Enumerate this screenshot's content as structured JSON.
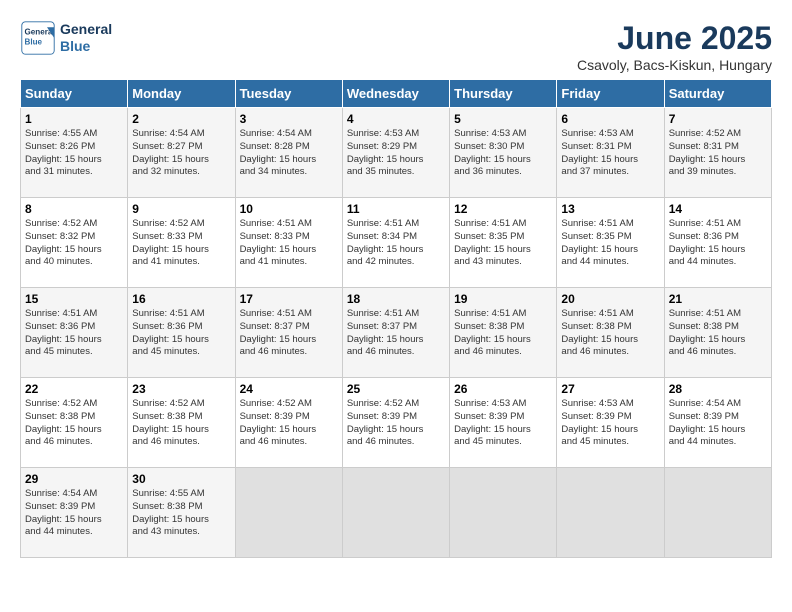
{
  "logo": {
    "line1": "General",
    "line2": "Blue"
  },
  "title": "June 2025",
  "location": "Csavoly, Bacs-Kiskun, Hungary",
  "days_of_week": [
    "Sunday",
    "Monday",
    "Tuesday",
    "Wednesday",
    "Thursday",
    "Friday",
    "Saturday"
  ],
  "weeks": [
    [
      {
        "day": "1",
        "info": "Sunrise: 4:55 AM\nSunset: 8:26 PM\nDaylight: 15 hours\nand 31 minutes."
      },
      {
        "day": "2",
        "info": "Sunrise: 4:54 AM\nSunset: 8:27 PM\nDaylight: 15 hours\nand 32 minutes."
      },
      {
        "day": "3",
        "info": "Sunrise: 4:54 AM\nSunset: 8:28 PM\nDaylight: 15 hours\nand 34 minutes."
      },
      {
        "day": "4",
        "info": "Sunrise: 4:53 AM\nSunset: 8:29 PM\nDaylight: 15 hours\nand 35 minutes."
      },
      {
        "day": "5",
        "info": "Sunrise: 4:53 AM\nSunset: 8:30 PM\nDaylight: 15 hours\nand 36 minutes."
      },
      {
        "day": "6",
        "info": "Sunrise: 4:53 AM\nSunset: 8:31 PM\nDaylight: 15 hours\nand 37 minutes."
      },
      {
        "day": "7",
        "info": "Sunrise: 4:52 AM\nSunset: 8:31 PM\nDaylight: 15 hours\nand 39 minutes."
      }
    ],
    [
      {
        "day": "8",
        "info": "Sunrise: 4:52 AM\nSunset: 8:32 PM\nDaylight: 15 hours\nand 40 minutes."
      },
      {
        "day": "9",
        "info": "Sunrise: 4:52 AM\nSunset: 8:33 PM\nDaylight: 15 hours\nand 41 minutes."
      },
      {
        "day": "10",
        "info": "Sunrise: 4:51 AM\nSunset: 8:33 PM\nDaylight: 15 hours\nand 41 minutes."
      },
      {
        "day": "11",
        "info": "Sunrise: 4:51 AM\nSunset: 8:34 PM\nDaylight: 15 hours\nand 42 minutes."
      },
      {
        "day": "12",
        "info": "Sunrise: 4:51 AM\nSunset: 8:35 PM\nDaylight: 15 hours\nand 43 minutes."
      },
      {
        "day": "13",
        "info": "Sunrise: 4:51 AM\nSunset: 8:35 PM\nDaylight: 15 hours\nand 44 minutes."
      },
      {
        "day": "14",
        "info": "Sunrise: 4:51 AM\nSunset: 8:36 PM\nDaylight: 15 hours\nand 44 minutes."
      }
    ],
    [
      {
        "day": "15",
        "info": "Sunrise: 4:51 AM\nSunset: 8:36 PM\nDaylight: 15 hours\nand 45 minutes."
      },
      {
        "day": "16",
        "info": "Sunrise: 4:51 AM\nSunset: 8:36 PM\nDaylight: 15 hours\nand 45 minutes."
      },
      {
        "day": "17",
        "info": "Sunrise: 4:51 AM\nSunset: 8:37 PM\nDaylight: 15 hours\nand 46 minutes."
      },
      {
        "day": "18",
        "info": "Sunrise: 4:51 AM\nSunset: 8:37 PM\nDaylight: 15 hours\nand 46 minutes."
      },
      {
        "day": "19",
        "info": "Sunrise: 4:51 AM\nSunset: 8:38 PM\nDaylight: 15 hours\nand 46 minutes."
      },
      {
        "day": "20",
        "info": "Sunrise: 4:51 AM\nSunset: 8:38 PM\nDaylight: 15 hours\nand 46 minutes."
      },
      {
        "day": "21",
        "info": "Sunrise: 4:51 AM\nSunset: 8:38 PM\nDaylight: 15 hours\nand 46 minutes."
      }
    ],
    [
      {
        "day": "22",
        "info": "Sunrise: 4:52 AM\nSunset: 8:38 PM\nDaylight: 15 hours\nand 46 minutes."
      },
      {
        "day": "23",
        "info": "Sunrise: 4:52 AM\nSunset: 8:38 PM\nDaylight: 15 hours\nand 46 minutes."
      },
      {
        "day": "24",
        "info": "Sunrise: 4:52 AM\nSunset: 8:39 PM\nDaylight: 15 hours\nand 46 minutes."
      },
      {
        "day": "25",
        "info": "Sunrise: 4:52 AM\nSunset: 8:39 PM\nDaylight: 15 hours\nand 46 minutes."
      },
      {
        "day": "26",
        "info": "Sunrise: 4:53 AM\nSunset: 8:39 PM\nDaylight: 15 hours\nand 45 minutes."
      },
      {
        "day": "27",
        "info": "Sunrise: 4:53 AM\nSunset: 8:39 PM\nDaylight: 15 hours\nand 45 minutes."
      },
      {
        "day": "28",
        "info": "Sunrise: 4:54 AM\nSunset: 8:39 PM\nDaylight: 15 hours\nand 44 minutes."
      }
    ],
    [
      {
        "day": "29",
        "info": "Sunrise: 4:54 AM\nSunset: 8:39 PM\nDaylight: 15 hours\nand 44 minutes."
      },
      {
        "day": "30",
        "info": "Sunrise: 4:55 AM\nSunset: 8:38 PM\nDaylight: 15 hours\nand 43 minutes."
      },
      {
        "day": "",
        "info": ""
      },
      {
        "day": "",
        "info": ""
      },
      {
        "day": "",
        "info": ""
      },
      {
        "day": "",
        "info": ""
      },
      {
        "day": "",
        "info": ""
      }
    ]
  ]
}
